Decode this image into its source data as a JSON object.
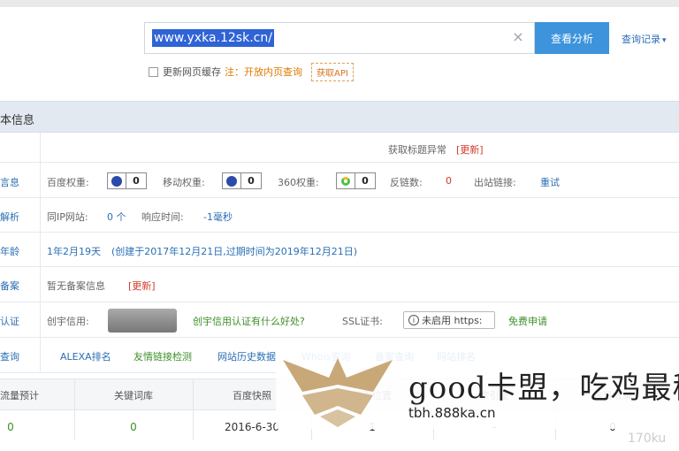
{
  "search": {
    "value": "www.yxka.12sk.cn/",
    "clear_icon": "×",
    "button_label": "查看分析",
    "history_label": "查询记录"
  },
  "options": {
    "refresh_cache_label": "更新网页缓存",
    "note_label": "注：",
    "note_text": "开放内页查询",
    "api_label": "获取API"
  },
  "section_title": "本信息",
  "title_row": {
    "text": "获取标题异常",
    "update_label": "[更新]"
  },
  "weights_row": {
    "label": "言息",
    "baidu_label": "百度权重:",
    "baidu_value": "0",
    "mobile_label": "移动权重:",
    "mobile_value": "0",
    "so360_label": "360权重:",
    "so360_value": "0",
    "backlinks_label": "反链数:",
    "backlinks_value": "0",
    "outlinks_label": "出站链接:",
    "outlinks_value": "重试"
  },
  "dns_row": {
    "label": "解析",
    "sameip_label": "同IP网站:",
    "sameip_value": "0 个",
    "response_label": "响应时间:",
    "response_value": "-1毫秒"
  },
  "age_row": {
    "label": "年龄",
    "age": "1年2月19天",
    "detail": "(创建于2017年12月21日,过期时间为2019年12月21日)"
  },
  "icp_row": {
    "label": "备案",
    "text": "暂无备案信息",
    "update_label": "[更新]"
  },
  "cert_row": {
    "label": "认证",
    "credit_label": "创宇信用:",
    "credit_link": "创宇信用认证有什么好处?",
    "ssl_label": "SSL证书:",
    "ssl_status": "未启用 https:",
    "ssl_apply": "免费申请"
  },
  "query_row": {
    "label": "查询",
    "links": [
      "ALEXA排名",
      "友情链接检测",
      "网站历史数据",
      "Whois查询",
      "备案查询",
      "网站排名"
    ]
  },
  "stats": {
    "headers": [
      "流量预计",
      "关键词库",
      "百度快照",
      "首页位置",
      "索引量",
      "今日收录"
    ],
    "values": [
      "0",
      "0",
      "2016-6-30",
      "1",
      "-",
      "0"
    ]
  },
  "watermark": {
    "text": "good卡盟，吃鸡最稳",
    "url": "tbh.888ka.cn",
    "corner": "170ku"
  },
  "colors": {
    "primary": "#3d93dc",
    "link": "#2b6fb4",
    "warn": "#d23b2b",
    "green": "#3e8f2a"
  }
}
